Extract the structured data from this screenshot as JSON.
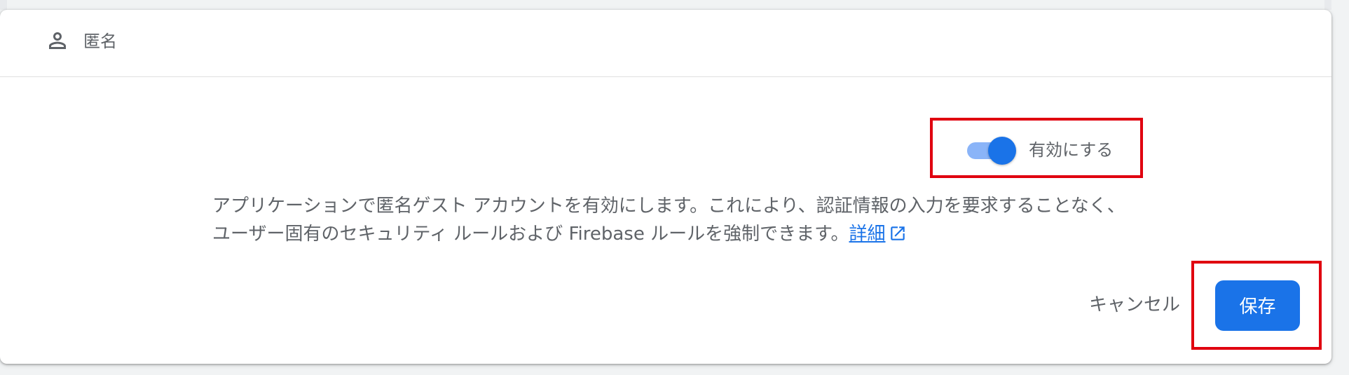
{
  "provider": {
    "name": "匿名",
    "icon": "person-icon"
  },
  "toggle": {
    "label": "有効にする",
    "enabled": true,
    "color": "#1a73e8"
  },
  "description": {
    "text": "アプリケーションで匿名ゲスト アカウントを有効にします。これにより、認証情報の入力を要求することなく、ユーザー固有のセキュリティ ルールおよび Firebase ルールを強制できます。",
    "learn_more": "詳細",
    "learn_more_icon": "external-link-icon"
  },
  "actions": {
    "cancel_label": "キャンセル",
    "save_label": "保存"
  },
  "highlight_color": "#e0000f"
}
